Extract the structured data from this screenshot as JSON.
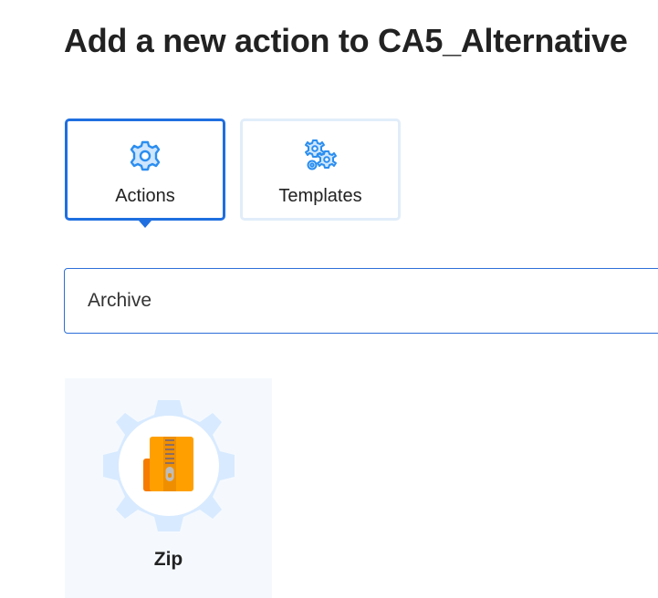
{
  "page": {
    "title": "Add a new action to CA5_Alternative"
  },
  "tabs": [
    {
      "label": "Actions",
      "icon": "gear-icon",
      "selected": true
    },
    {
      "label": "Templates",
      "icon": "gears-icon",
      "selected": false
    }
  ],
  "search": {
    "value": "Archive"
  },
  "results": [
    {
      "label": "Zip",
      "icon": "zip-archive-icon"
    }
  ],
  "colors": {
    "accent": "#1f6fe0",
    "icon_blue": "#2b8ef0",
    "card_background": "#f5f9fe",
    "gear_badge": "#d8eaff",
    "zip_orange": "#ffa000"
  }
}
